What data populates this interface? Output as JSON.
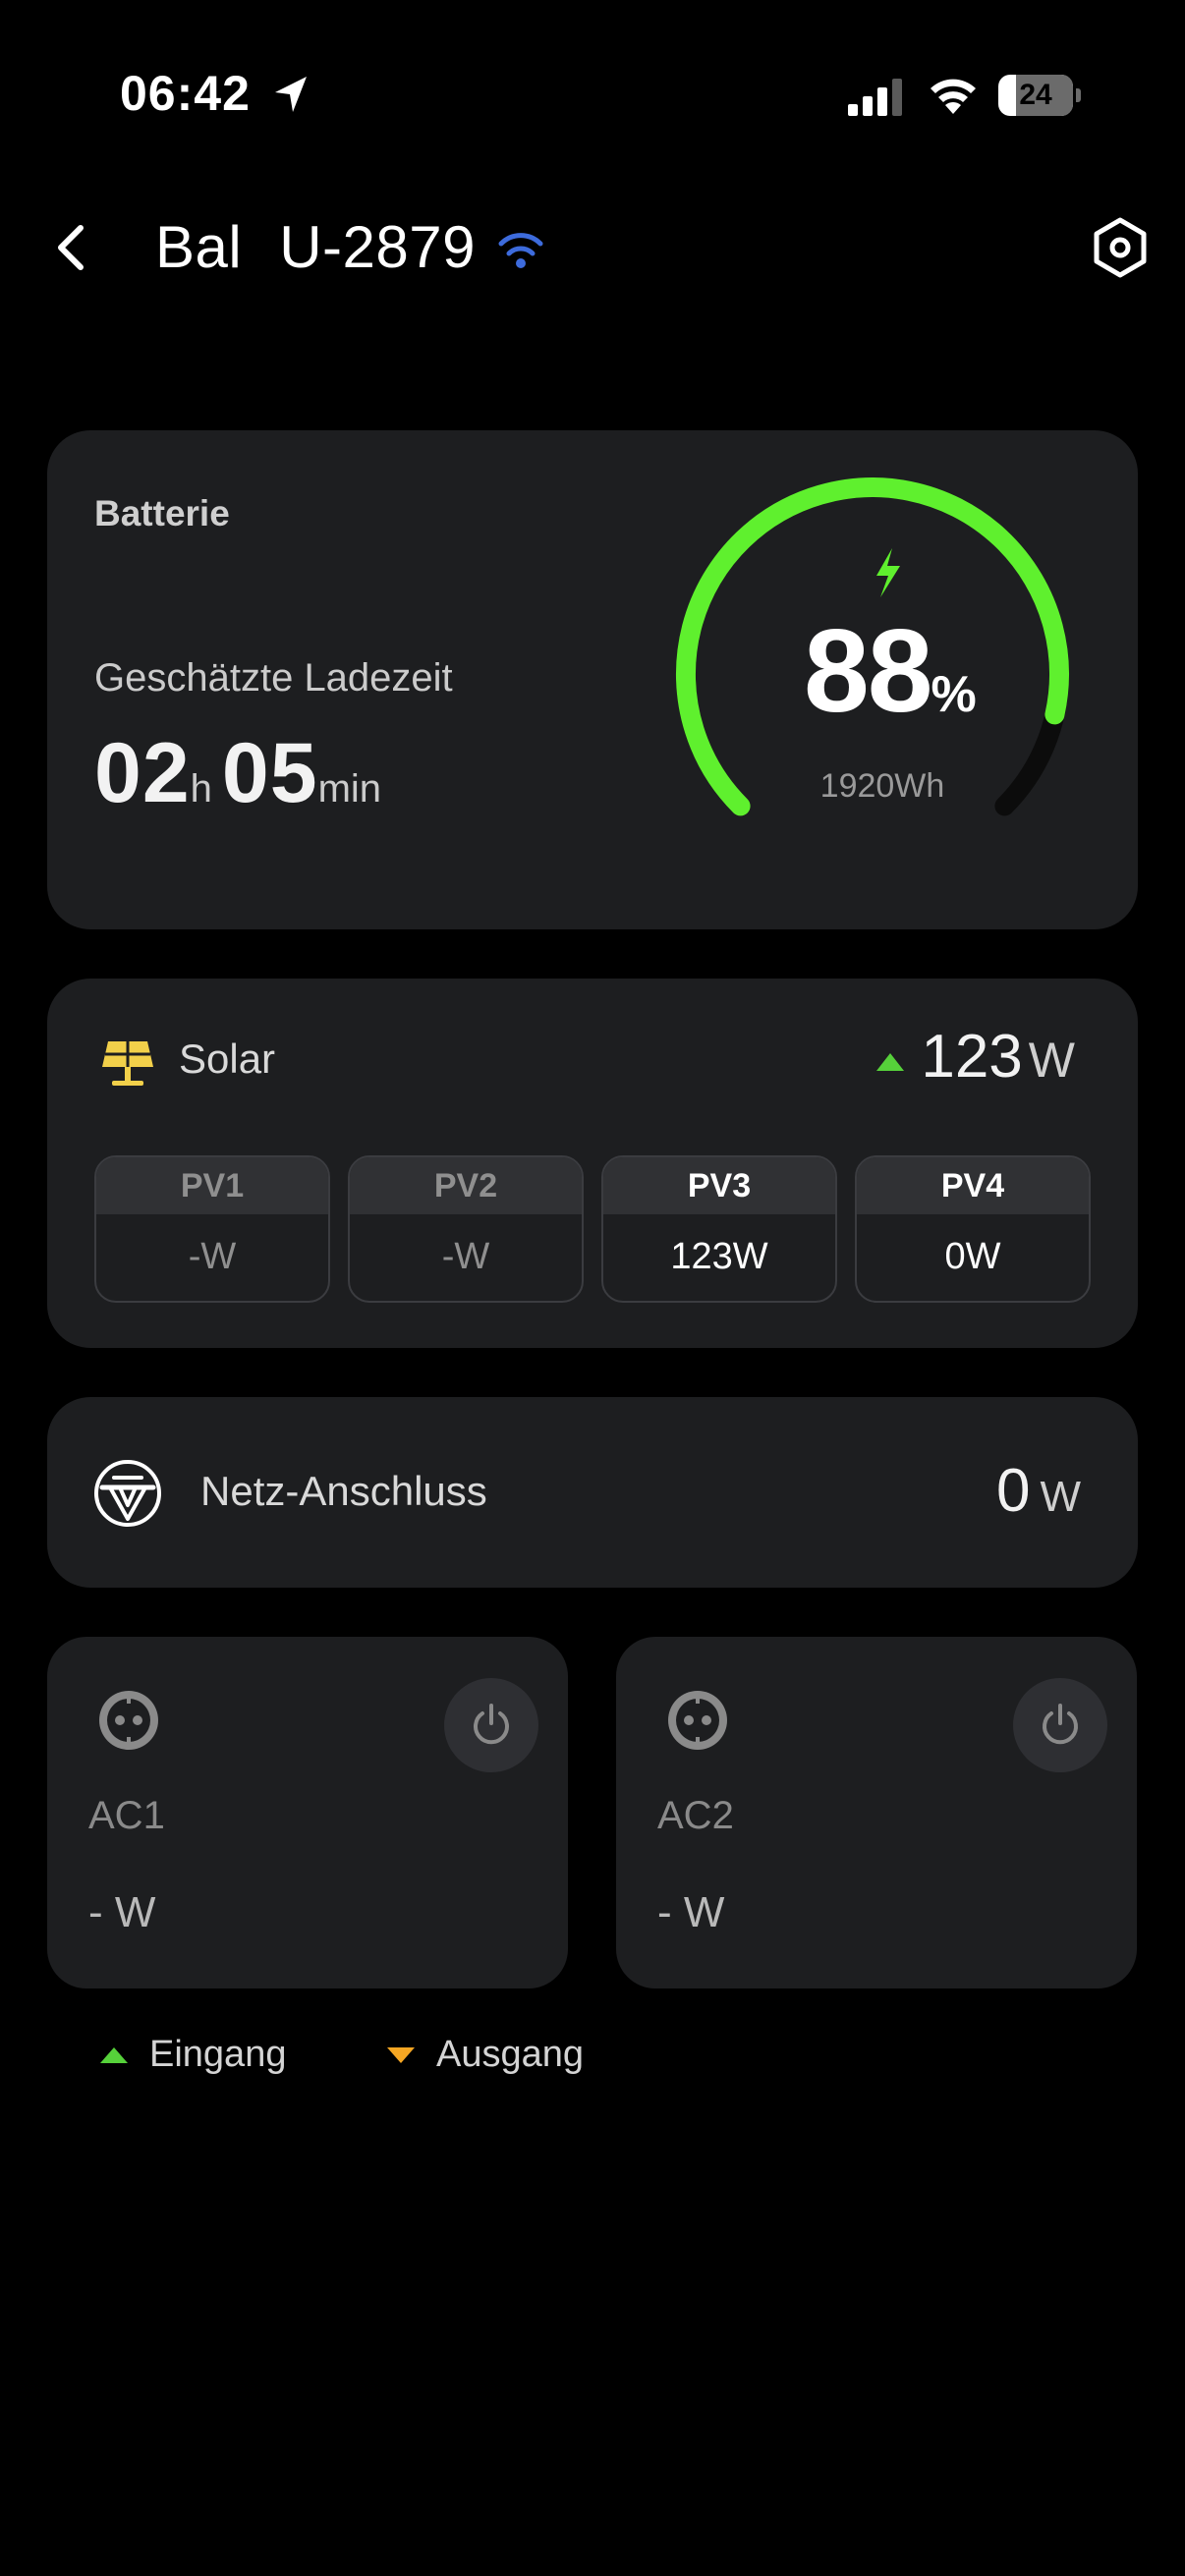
{
  "status_bar": {
    "time": "06:42",
    "battery_level": "24",
    "battery_fraction": 0.24
  },
  "header": {
    "title_part1": "Bal",
    "title_part2": "U-2879",
    "connection_color": "#3d6bdc"
  },
  "battery_card": {
    "label": "Batterie",
    "eta_label": "Geschätzte Ladezeit",
    "eta_hours": "02",
    "eta_hours_unit": "h",
    "eta_minutes": "05",
    "eta_minutes_unit": "min",
    "percent": "88",
    "percent_unit": "%",
    "percent_fraction": 0.88,
    "energy": "1920Wh",
    "gauge_color": "#5ff02e",
    "charging": true
  },
  "solar": {
    "label": "Solar",
    "value": "123",
    "unit": "W",
    "direction": "input",
    "inputs": [
      {
        "name": "PV1",
        "value": "-W",
        "active": false
      },
      {
        "name": "PV2",
        "value": "-W",
        "active": false
      },
      {
        "name": "PV3",
        "value": "123W",
        "active": true
      },
      {
        "name": "PV4",
        "value": "0W",
        "active": true
      }
    ]
  },
  "grid": {
    "label": "Netz-Anschluss",
    "value": "0",
    "unit": "W"
  },
  "ac_outputs": [
    {
      "label": "AC1",
      "value": "- W"
    },
    {
      "label": "AC2",
      "value": "- W"
    }
  ],
  "legend": {
    "input_label": "Eingang",
    "output_label": "Ausgang",
    "input_color": "#56d13a",
    "output_color": "#f5a623"
  }
}
